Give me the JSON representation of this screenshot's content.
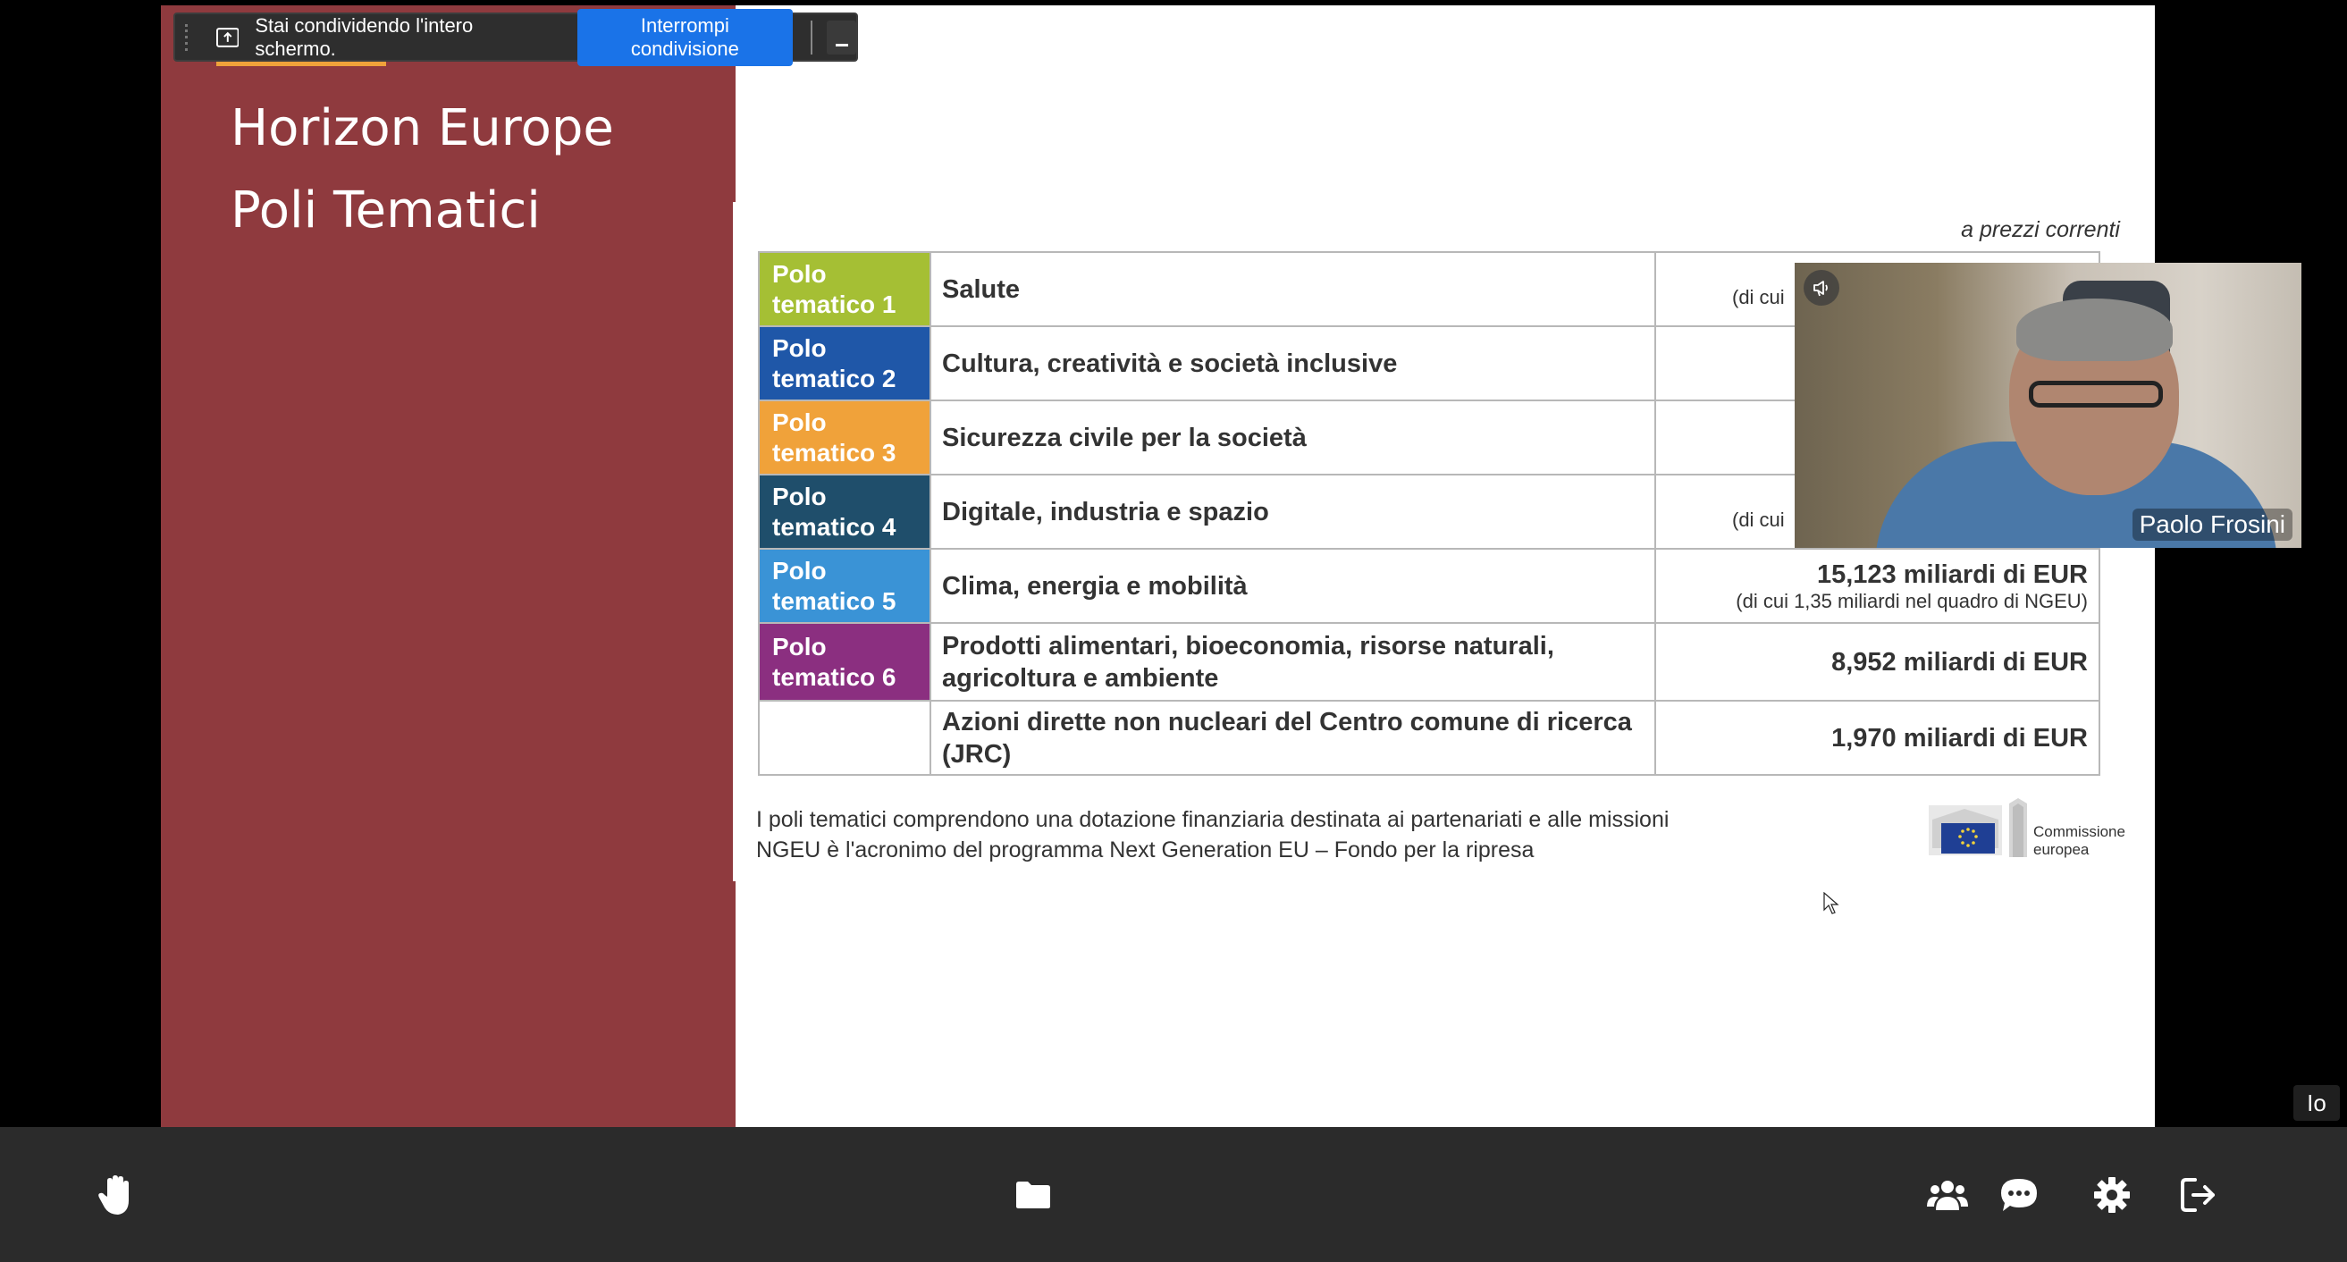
{
  "slide": {
    "title_line1": "Horizon Europe",
    "title_line2": "Poli Tematici",
    "prezzi_note": "a prezzi correnti",
    "rows": [
      {
        "tag": "Polo tematico 1",
        "tag_color": "#a5bf34",
        "name": "Salute",
        "amount_partial": "(di cui"
      },
      {
        "tag": "Polo tematico 2",
        "tag_color": "#1f57a8",
        "name": "Cultura, creatività e società inclusive"
      },
      {
        "tag": "Polo tematico 3",
        "tag_color": "#f0a23a",
        "name": "Sicurezza civile per la società"
      },
      {
        "tag": "Polo tematico 4",
        "tag_color": "#1f4e6b",
        "name": "Digitale, industria e spazio",
        "amount_partial": "(di cui"
      },
      {
        "tag": "Polo tematico 5",
        "tag_color": "#3a93d6",
        "name": "Clima, energia e mobilità",
        "amount": "15,123 miliardi di EUR",
        "amount_sub": "(di cui 1,35 miliardi nel quadro di NGEU)"
      },
      {
        "tag": "Polo tematico 6",
        "tag_color": "#8b2f80",
        "name": "Prodotti alimentari, bioeconomia, risorse naturali, agricoltura e ambiente",
        "amount": "8,952 miliardi di EUR"
      },
      {
        "tag": "",
        "tag_color": "#ffffff",
        "name": "Azioni dirette non nucleari del Centro comune di ricerca (JRC)",
        "amount": "1,970 miliardi di EUR"
      }
    ],
    "footnote_line1": "I poli tematici comprendono una dotazione finanziaria destinata ai partenariati e alle missioni",
    "footnote_line2": "NGEU è l'acronimo del programma Next Generation EU – Fondo per la ripresa",
    "logo_text_line1": "Commissione",
    "logo_text_line2": "europea"
  },
  "share_bar": {
    "message": "Stai condividendo l'intero schermo.",
    "stop_label": "Interrompi condivisione"
  },
  "video": {
    "participant_name": "Paolo Frosini"
  },
  "self_label": "Io",
  "toolbar": {
    "icons": [
      "raise-hand-icon",
      "folder-icon",
      "participants-icon",
      "chat-icon",
      "settings-icon",
      "leave-icon"
    ]
  },
  "colors": {
    "slide_left_bg": "#8f3a3e",
    "accent": "#f0a23a",
    "stop_button": "#1a73e8",
    "toolbar_bg": "#2b2b2b"
  }
}
